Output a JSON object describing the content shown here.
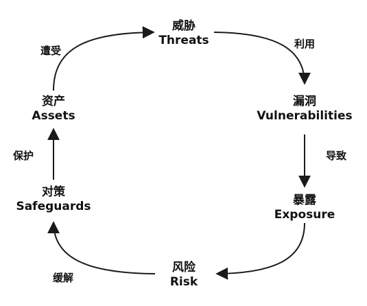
{
  "nodes": {
    "threats": {
      "zh": "威胁",
      "en": "Threats"
    },
    "vulnerabilities": {
      "zh": "漏洞",
      "en": "Vulnerabilities"
    },
    "exposure": {
      "zh": "暴露",
      "en": "Exposure"
    },
    "risk": {
      "zh": "风险",
      "en": "Risk"
    },
    "safeguards": {
      "zh": "对策",
      "en": "Safeguards"
    },
    "assets": {
      "zh": "资产",
      "en": "Assets"
    }
  },
  "edges": {
    "threats_to_vulnerabilities": "利用",
    "vulnerabilities_to_exposure": "导致",
    "exposure_to_risk": "缓解",
    "safeguards_to_assets": "保护",
    "assets_to_threats": "遭受"
  },
  "colors": {
    "line": "#1a1a1a",
    "text": "#111111",
    "background": "#ffffff"
  }
}
